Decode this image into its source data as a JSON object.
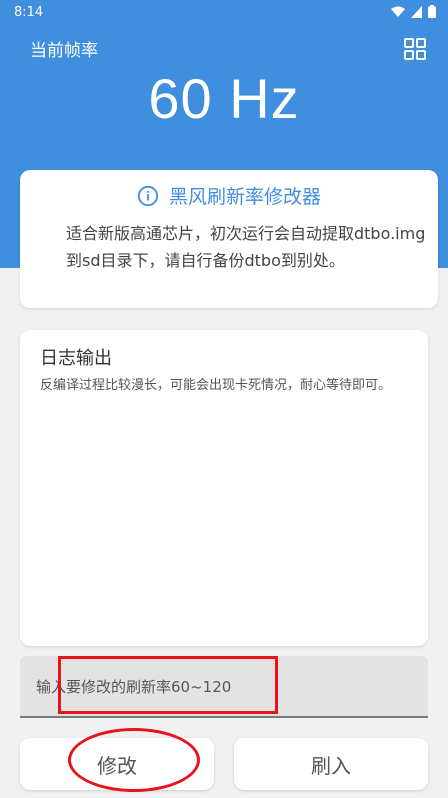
{
  "status_bar": {
    "time": "8:14"
  },
  "header": {
    "title": "当前帧率",
    "refresh_rate": "60 Hz",
    "accent_color": "#3f8fde"
  },
  "info_card": {
    "title": "黑风刷新率修改器",
    "description": "适合新版高通芯片，初次运行会自动提取dtbo.img到sd目录下，请自行备份dtbo到别处。"
  },
  "log_card": {
    "title": "日志输出",
    "text": "反编译过程比较漫长，可能会出现卡死情况，耐心等待即可。"
  },
  "input": {
    "placeholder": "输入要修改的刷新率60~120"
  },
  "buttons": {
    "modify": "修改",
    "flash": "刷入"
  },
  "annotation_color": "#e8141c"
}
